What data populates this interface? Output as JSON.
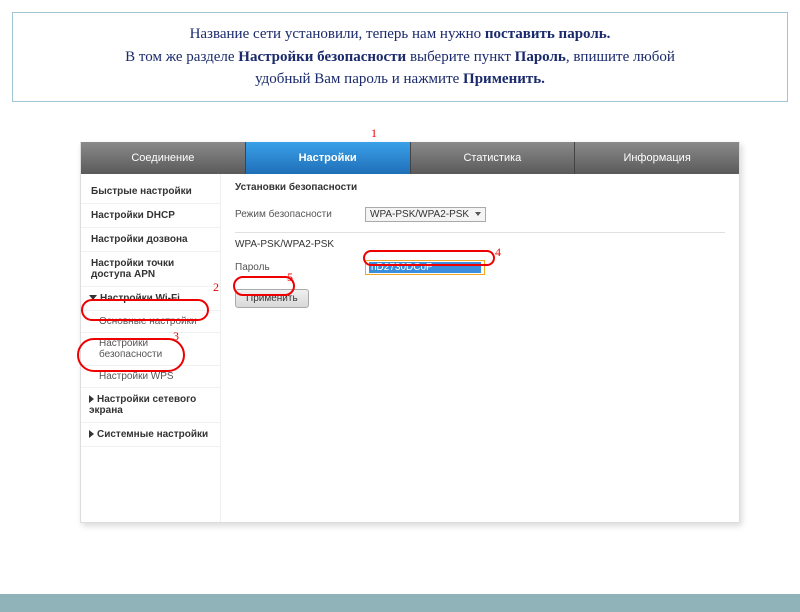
{
  "instruction": {
    "line1_a": "Название сети  установили, теперь нам нужно ",
    "line1_b": "поставить пароль.",
    "line2_a": "В том же разделе ",
    "line2_b": "Настройки безопасности",
    "line2_c": " выберите пункт ",
    "line2_d": "Пароль",
    "line2_e": ", впишите любой",
    "line3_a": "удобный Вам пароль и нажмите ",
    "line3_b": "Применить."
  },
  "tabs": {
    "connection": "Соединение",
    "settings": "Настройки",
    "statistics": "Статистика",
    "info": "Информация"
  },
  "sidebar": {
    "quick": "Быстрые настройки",
    "dhcp": "Настройки DHCP",
    "dial": "Настройки дозвона",
    "apn": "Настройки точки доступа APN",
    "wifi": "Настройки Wi-Fi",
    "wifi_basic": "Основные настройки",
    "wifi_security": "Настройки безопасности",
    "wifi_wps": "Настройки WPS",
    "firewall": "Настройки сетевого экрана",
    "system": "Системные настройки"
  },
  "main": {
    "heading": "Установки безопасности",
    "mode_label": "Режим безопасности",
    "mode_value": "WPA-PSK/WPA2-PSK",
    "section": "WPA-PSK/WPA2-PSK",
    "password_label": "Пароль",
    "password_value": "nD2730DCoP",
    "apply": "Применить"
  },
  "markers": {
    "m1": "1",
    "m2": "2",
    "m3": "3",
    "m4": "4",
    "m5": "5"
  }
}
